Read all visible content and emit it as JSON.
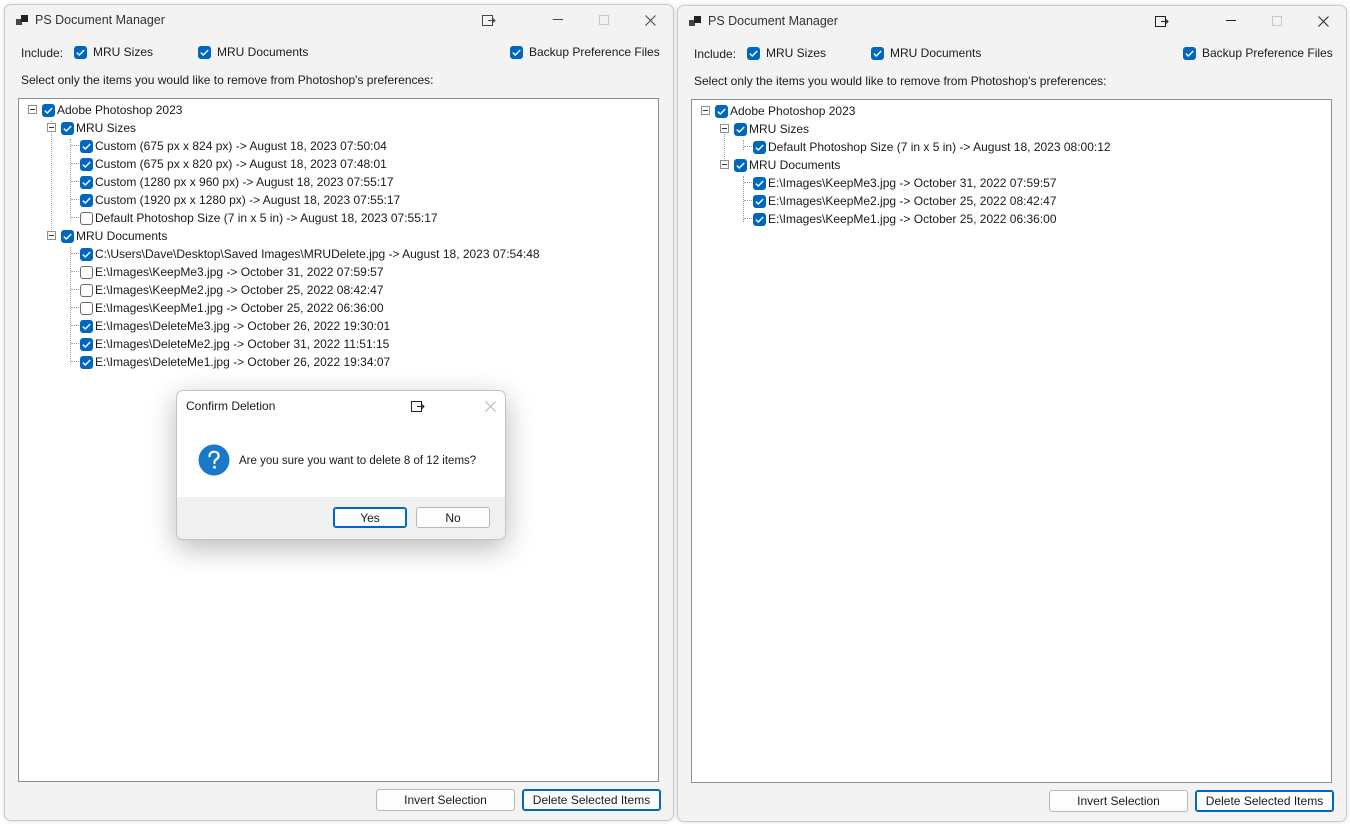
{
  "left_window": {
    "title": "PS Document Manager",
    "include_label": "Include:",
    "options": {
      "mru_sizes": {
        "label": "MRU Sizes",
        "checked": true
      },
      "mru_documents": {
        "label": "MRU Documents",
        "checked": true
      },
      "backup": {
        "label": "Backup Preference Files",
        "checked": true
      }
    },
    "instruction": "Select only the items you would like to remove from Photoshop's preferences:",
    "tree": {
      "root": {
        "label": "Adobe Photoshop 2023",
        "checked": true
      },
      "sizes_group": {
        "label": "MRU Sizes",
        "checked": true
      },
      "sizes": [
        {
          "label": "Custom (675 px x 824 px) -> August 18, 2023 07:50:04",
          "checked": true
        },
        {
          "label": "Custom (675 px x 820 px) -> August 18, 2023 07:48:01",
          "checked": true
        },
        {
          "label": "Custom (1280 px x 960 px) -> August 18, 2023 07:55:17",
          "checked": true
        },
        {
          "label": "Custom (1920 px x 1280 px) -> August 18, 2023 07:55:17",
          "checked": true
        },
        {
          "label": "Default Photoshop Size (7 in x 5 in) -> August 18, 2023 07:55:17",
          "checked": false
        }
      ],
      "docs_group": {
        "label": "MRU Documents",
        "checked": true
      },
      "docs": [
        {
          "label": "C:\\Users\\Dave\\Desktop\\Saved Images\\MRUDelete.jpg -> August 18, 2023 07:54:48",
          "checked": true
        },
        {
          "label": "E:\\Images\\KeepMe3.jpg -> October 31, 2022 07:59:57",
          "checked": false
        },
        {
          "label": "E:\\Images\\KeepMe2.jpg -> October 25, 2022 08:42:47",
          "checked": false
        },
        {
          "label": "E:\\Images\\KeepMe1.jpg -> October 25, 2022 06:36:00",
          "checked": false
        },
        {
          "label": "E:\\Images\\DeleteMe3.jpg -> October 26, 2022 19:30:01",
          "checked": true
        },
        {
          "label": "E:\\Images\\DeleteMe2.jpg -> October 31, 2022 11:51:15",
          "checked": true
        },
        {
          "label": "E:\\Images\\DeleteMe1.jpg -> October 26, 2022 19:34:07",
          "checked": true
        }
      ]
    },
    "invert_label": "Invert Selection",
    "delete_label": "Delete Selected Items"
  },
  "right_window": {
    "title": "PS Document Manager",
    "include_label": "Include:",
    "options": {
      "mru_sizes": {
        "label": "MRU Sizes",
        "checked": true
      },
      "mru_documents": {
        "label": "MRU Documents",
        "checked": true
      },
      "backup": {
        "label": "Backup Preference Files",
        "checked": true
      }
    },
    "instruction": "Select only the items you would like to remove from Photoshop's preferences:",
    "tree": {
      "root": {
        "label": "Adobe Photoshop 2023",
        "checked": true
      },
      "sizes_group": {
        "label": "MRU Sizes",
        "checked": true
      },
      "sizes": [
        {
          "label": "Default Photoshop Size (7 in x 5 in) -> August 18, 2023 08:00:12",
          "checked": true
        }
      ],
      "docs_group": {
        "label": "MRU Documents",
        "checked": true
      },
      "docs": [
        {
          "label": "E:\\Images\\KeepMe3.jpg -> October 31, 2022 07:59:57",
          "checked": true
        },
        {
          "label": "E:\\Images\\KeepMe2.jpg -> October 25, 2022 08:42:47",
          "checked": true
        },
        {
          "label": "E:\\Images\\KeepMe1.jpg -> October 25, 2022 06:36:00",
          "checked": true
        }
      ]
    },
    "invert_label": "Invert Selection",
    "delete_label": "Delete Selected Items"
  },
  "dialog": {
    "title": "Confirm Deletion",
    "message": "Are you sure you want to delete 8 of 12 items?",
    "icon": "question-icon",
    "yes_label": "Yes",
    "no_label": "No"
  },
  "colors": {
    "accent": "#0067c0",
    "window_bg": "#f3f3f3",
    "dialog_footer": "#f0f0f0"
  }
}
